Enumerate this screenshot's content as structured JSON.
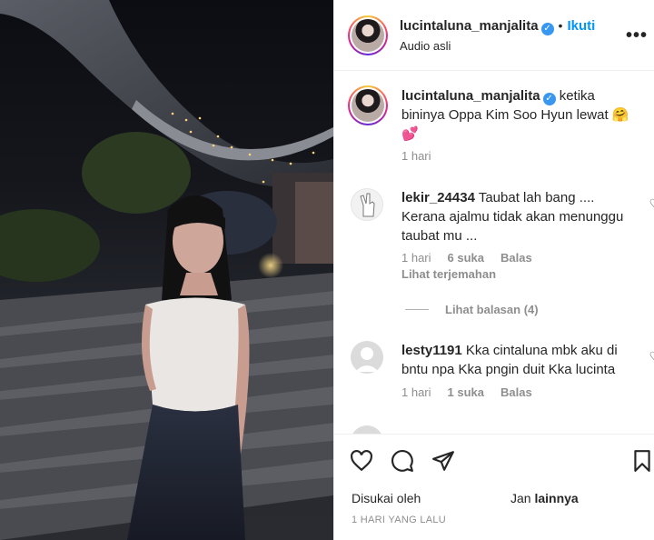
{
  "post": {
    "author": "lucintaluna_manjalita",
    "follow_label": "Ikuti",
    "audio": "Audio asli",
    "more_icon": "more-horizontal-icon",
    "verified_icon": "verified-badge-icon"
  },
  "caption": {
    "author": "lucintaluna_manjalita",
    "text": "ketika bininya Oppa Kim Soo Hyun lewat 🤗 💕",
    "age": "1 hari"
  },
  "comments": [
    {
      "author": "lekir_24434",
      "text": "Taubat lah bang .... Kerana ajalmu tidak akan menunggu taubat mu ...",
      "age": "1 hari",
      "likes": "6 suka",
      "reply": "Balas",
      "translate": "Lihat terjemahan"
    },
    {
      "author": "lesty1191",
      "text": "Kka cintaluna mbk aku di bntu npa Kka pngin duit Kka lucinta",
      "age": "1 hari",
      "likes": "1 suka",
      "reply": "Balas"
    }
  ],
  "view_replies": "Lihat balasan (4)",
  "actions": {
    "liked_prefix": "Disukai oleh",
    "liked_user": "Jan",
    "liked_suffix": "lainnya",
    "timestamp": "1 HARI YANG LALU"
  },
  "colors": {
    "accent": "#0095f6",
    "verified": "#3897f0",
    "muted": "#8e8e8e"
  }
}
